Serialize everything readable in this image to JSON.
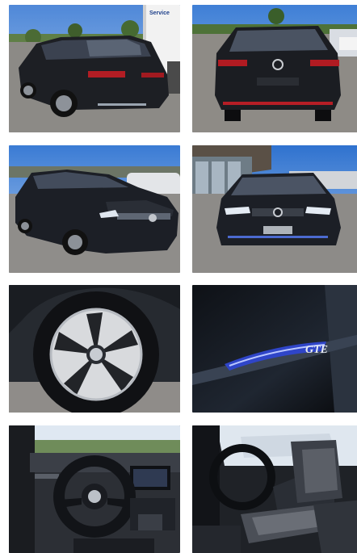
{
  "gallery": {
    "photos": [
      {
        "name": "photo-rear-left-three-quarter",
        "sign_text": "Service"
      },
      {
        "name": "photo-rear"
      },
      {
        "name": "photo-front-left-three-quarter"
      },
      {
        "name": "photo-front"
      },
      {
        "name": "photo-wheel"
      },
      {
        "name": "photo-gte-badge",
        "badge_text": "GTE"
      },
      {
        "name": "photo-dashboard"
      },
      {
        "name": "photo-front-seats"
      }
    ]
  }
}
